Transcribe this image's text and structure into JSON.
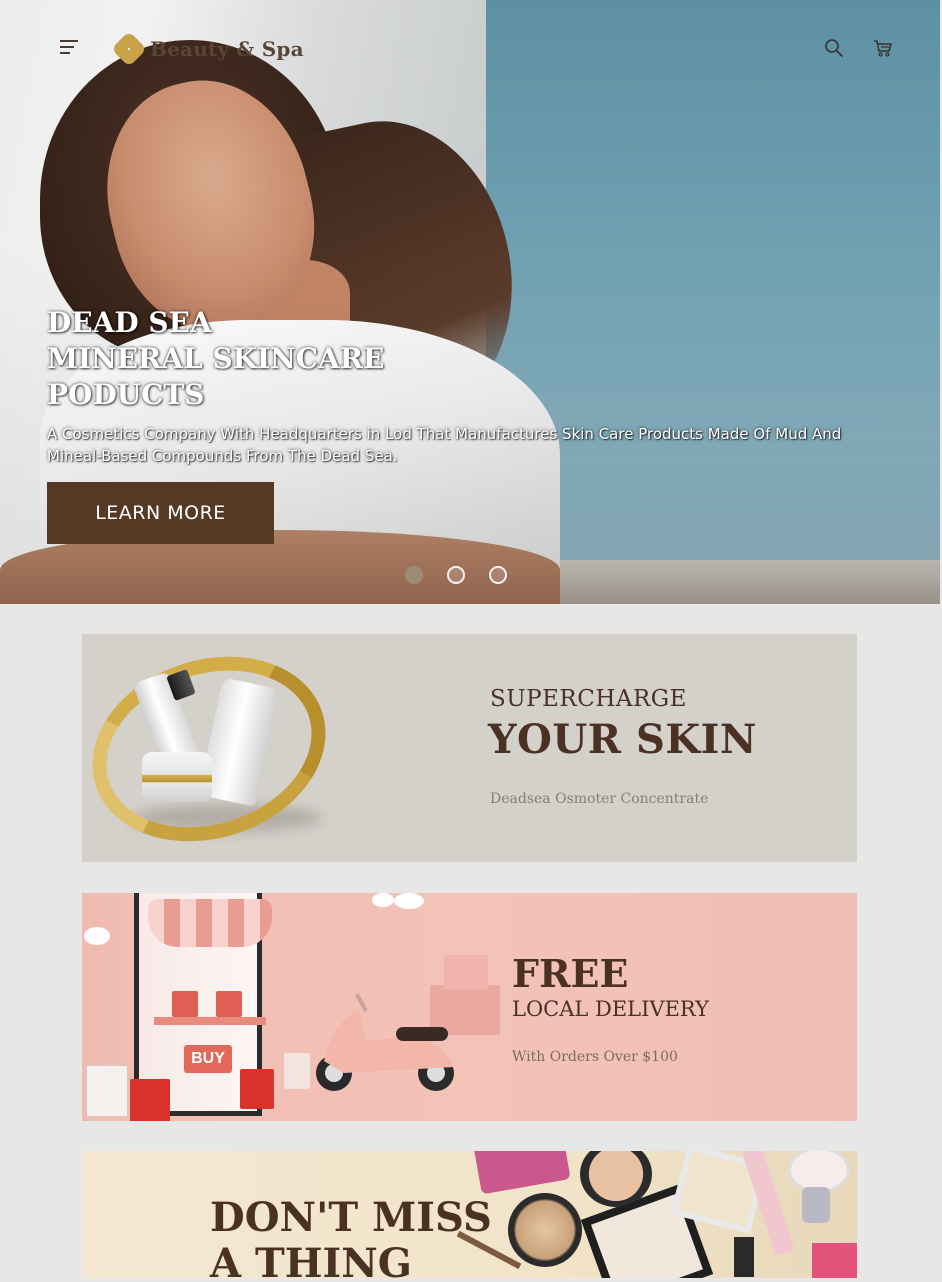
{
  "header": {
    "brand": "Beauty & Spa",
    "menu_icon": "menu-icon",
    "search_icon": "search-icon",
    "cart_icon": "cart-icon"
  },
  "hero": {
    "title_lines": [
      "DEAD SEA",
      "MINERAL SKINCARE",
      "PODUCTS"
    ],
    "description": "A Cosmetics Company With Headquarters in Lod That Manufactures Skin Care Products Made Of Mud And Mineal-Based Compounds From The Dead Sea.",
    "cta": "LEARN MORE",
    "slides_total": 3,
    "active_slide": 1
  },
  "banners": [
    {
      "line1": "SUPERCHARGE",
      "line2": "YOUR SKIN",
      "line3": "Deadsea Osmoter Concentrate"
    },
    {
      "line1": "FREE",
      "line2": "LOCAL DELIVERY",
      "line3": "With Orders Over $100",
      "sign": "BUY"
    },
    {
      "line1": "DON'T MISS",
      "line2": "A THING"
    }
  ],
  "colors": {
    "accent_brown": "#553925",
    "heading_brown": "#4b3024",
    "page_bg": "#e7e7e7",
    "gold": "#c9a24a"
  }
}
